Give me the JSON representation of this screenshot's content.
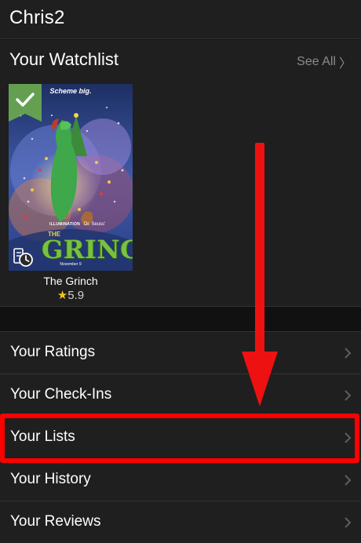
{
  "header": {
    "title": "Chris2"
  },
  "watchlist": {
    "title": "Your Watchlist",
    "see_all": "See All",
    "items": [
      {
        "title": "The Grinch",
        "rating": "5.9",
        "star_icon": "★",
        "in_watchlist": true,
        "poster": {
          "tagline": "Scheme big.",
          "studio": "ILLUMINATION",
          "credit": "Dr. Seuss'",
          "logo_small": "THE",
          "logo": "GRINCH",
          "date": "November 9"
        }
      }
    ]
  },
  "menu": {
    "items": [
      {
        "label": "Your Ratings"
      },
      {
        "label": "Your Check-Ins"
      },
      {
        "label": "Your Lists",
        "highlighted": true
      },
      {
        "label": "Your History"
      },
      {
        "label": "Your Reviews"
      }
    ]
  },
  "colors": {
    "background": "#1f1f1f",
    "accent_star": "#f5c518",
    "annotation_red": "#ff0000",
    "check_badge": "#6aa84f"
  },
  "icons": {
    "watchlist_check": "checkmark-icon",
    "poster_status": "clock-list-icon",
    "row_chevron": "chevron-right-icon",
    "see_all_chevron": "chevron-right-icon"
  }
}
